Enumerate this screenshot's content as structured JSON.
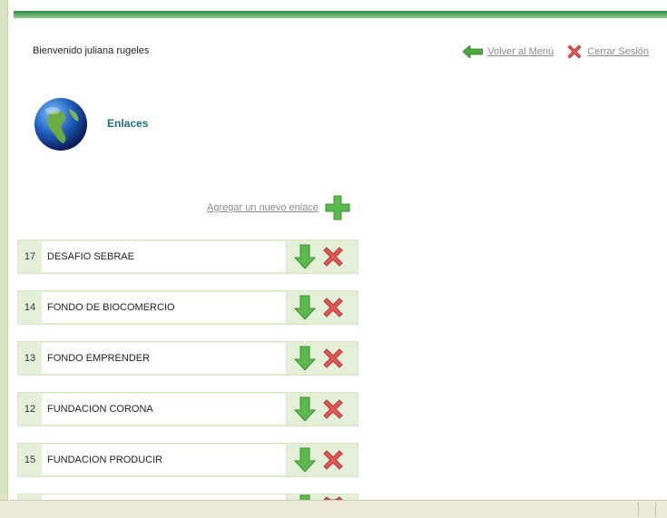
{
  "header": {
    "welcome_text": "Bienvenido juliana rugeles",
    "back_link": "Volver al Menú",
    "logout_link": "Cerrar Sesión"
  },
  "section": {
    "title": "Enlaces",
    "add_link": "Agregar un nuevo enlace"
  },
  "links": [
    {
      "id": "17",
      "name": "DESAFIO SEBRAE"
    },
    {
      "id": "14",
      "name": "FONDO DE BIOCOMERCIO"
    },
    {
      "id": "13",
      "name": "FONDO EMPRENDER"
    },
    {
      "id": "12",
      "name": "FUNDACION CORONA"
    },
    {
      "id": "15",
      "name": "FUNDACION PRODUCIR"
    }
  ],
  "icons": {
    "back": "green-arrow-left-icon",
    "logout": "red-x-icon",
    "add": "green-plus-icon",
    "move_down": "green-arrow-down-icon",
    "delete": "red-x-icon",
    "section": "globe-icon"
  }
}
